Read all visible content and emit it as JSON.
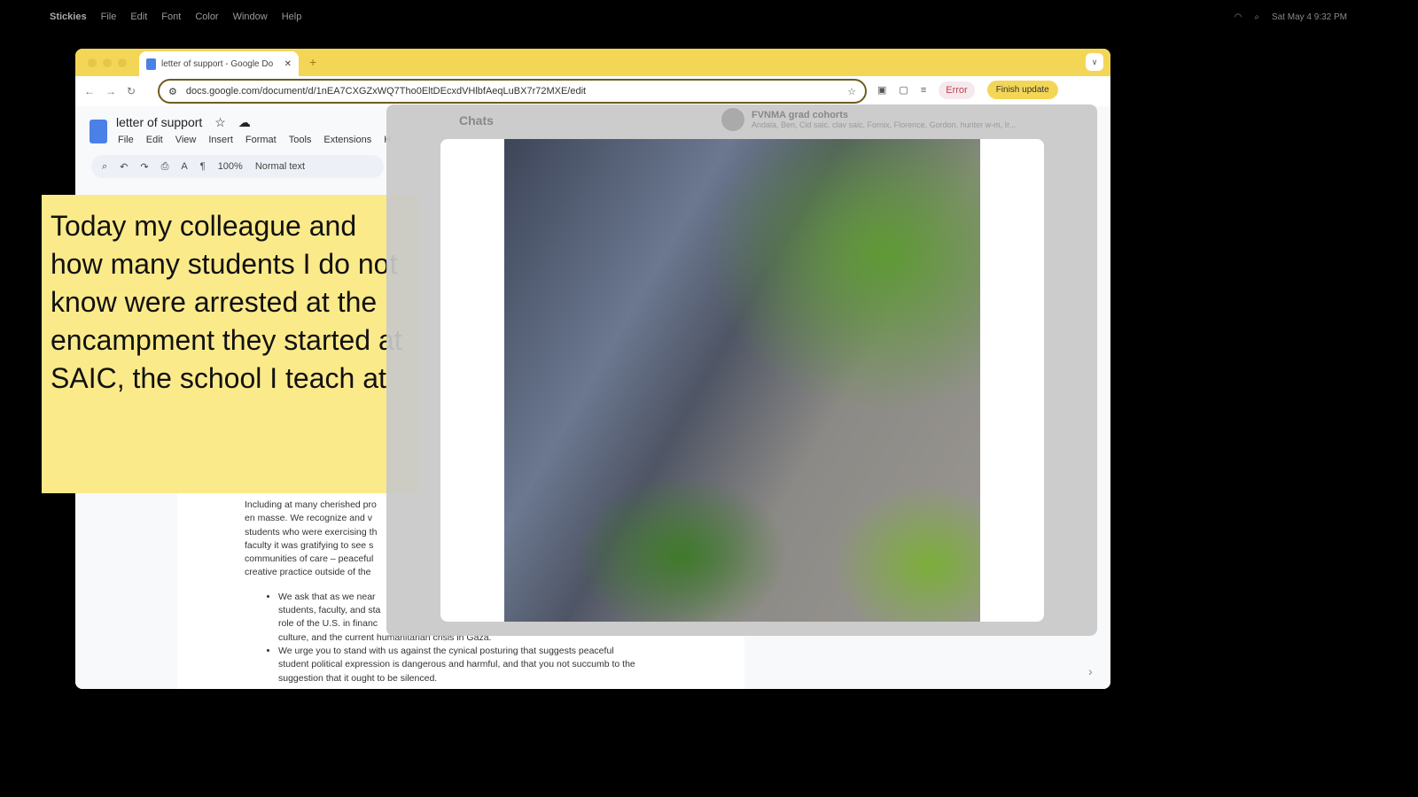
{
  "menubar": {
    "app": "Stickies",
    "items": [
      "File",
      "Edit",
      "Font",
      "Color",
      "Window",
      "Help"
    ],
    "clock": "Sat May 4  9:32 PM"
  },
  "browser": {
    "tab_title": "letter of support - Google Do",
    "url": "docs.google.com/document/d/1nEA7CXGZxWQ7Tho0EltDEcxdVHlbfAeqLuBX7r72MXE/edit",
    "profile_label": "Error",
    "update_label": "Finish update",
    "accent": "#f4d657"
  },
  "docs": {
    "title": "letter of support",
    "menu": [
      "File",
      "Edit",
      "View",
      "Insert",
      "Format",
      "Tools",
      "Extensions",
      "H"
    ],
    "zoom": "100%",
    "style": "Normal text",
    "paragraph": [
      "Including at many cherished pro",
      "en masse.  We recognize and v",
      "students who were exercising th",
      "faculty it was gratifying to see s",
      "communities of care – peaceful",
      "creative practice outside of the"
    ],
    "bullets": [
      "We ask that as we near",
      "students, faculty, and sta",
      "role of the U.S. in financ",
      "culture, and the current humanitarian crisis in Gaza.",
      "We urge you to stand with us against the cynical posturing that suggests peaceful",
      "student political expression is dangerous and harmful, and that you not succumb to the",
      "suggestion that it ought to be silenced."
    ]
  },
  "sticky": {
    "text": "Today my colleague and how many students I do not know were arrested at the encampment they started at SAIC, the school I teach at",
    "color": "#fbea8a"
  },
  "chats": {
    "title": "Chats",
    "group_name": "FVNMA grad cohorts",
    "members": "Andala, Ben, Cid saic, clav saic, Fornix, Florence, Gordon, hunter w-m, Ir..."
  }
}
